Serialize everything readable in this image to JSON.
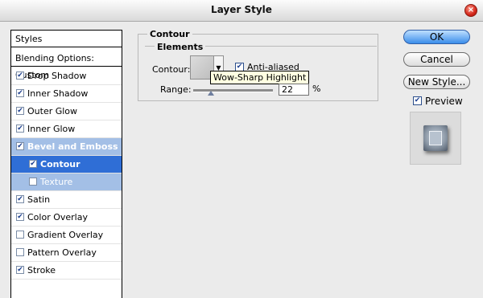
{
  "window": {
    "title": "Layer Style"
  },
  "styles_list": {
    "header": "Styles",
    "blending": "Blending Options: Custom",
    "items": [
      {
        "label": "Drop Shadow",
        "checked": true
      },
      {
        "label": "Inner Shadow",
        "checked": true
      },
      {
        "label": "Outer Glow",
        "checked": true
      },
      {
        "label": "Inner Glow",
        "checked": true
      },
      {
        "label": "Bevel and Emboss",
        "checked": true
      },
      {
        "label": "Contour",
        "checked": true
      },
      {
        "label": "Texture",
        "checked": false
      },
      {
        "label": "Satin",
        "checked": true
      },
      {
        "label": "Color Overlay",
        "checked": true
      },
      {
        "label": "Gradient Overlay",
        "checked": false
      },
      {
        "label": "Pattern Overlay",
        "checked": false
      },
      {
        "label": "Stroke",
        "checked": true
      }
    ]
  },
  "contour_panel": {
    "title": "Contour",
    "elements_title": "Elements",
    "contour_label": "Contour:",
    "anti_aliased_label": "Anti-aliased",
    "anti_aliased_checked": true,
    "tooltip": "Wow-Sharp Highlight",
    "range_label": "Range:",
    "range_value": "22",
    "range_unit": "%"
  },
  "buttons": {
    "ok": "OK",
    "cancel": "Cancel",
    "new_style": "New Style..."
  },
  "preview": {
    "label": "Preview",
    "checked": true
  },
  "colors": {
    "selected": "#2f6ed6",
    "sub_selected": "#a3bfe6",
    "ok_button": "#3a8dea"
  }
}
